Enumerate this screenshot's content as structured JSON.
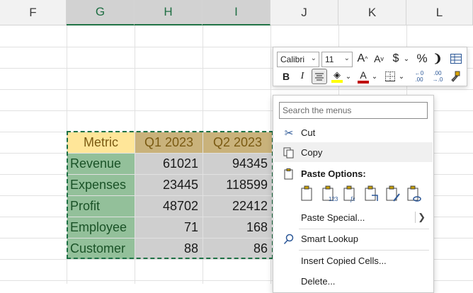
{
  "columns": [
    "F",
    "G",
    "H",
    "I",
    "J",
    "K",
    "L"
  ],
  "table": {
    "headers": [
      "Metric",
      "Q1 2023",
      "Q2 2023"
    ],
    "rows": [
      {
        "metric": "Revenue",
        "q1": "61021",
        "q2": "94345"
      },
      {
        "metric": "Expenses",
        "q1": "23445",
        "q2": "118599"
      },
      {
        "metric": "Profit",
        "q1": "48702",
        "q2": "22412"
      },
      {
        "metric": "Employee",
        "q1": "71",
        "q2": "168"
      },
      {
        "metric": "Customer",
        "q1": "88",
        "q2": "86"
      }
    ]
  },
  "mini_toolbar": {
    "font_name": "Calibri",
    "font_size": "11",
    "grow_font": "A",
    "shrink_font": "A",
    "currency": "$",
    "percent": "%",
    "comma": "❩",
    "bold": "B",
    "italic": "I",
    "font_color_letter": "A",
    "decrease_decimal_top": "←0",
    "decrease_decimal_bottom": ".00",
    "increase_decimal_top": ".00",
    "increase_decimal_bottom": "→.0"
  },
  "context_menu": {
    "search_placeholder": "Search the menus",
    "cut": "Cut",
    "copy": "Copy",
    "paste_options_header": "Paste Options:",
    "paste_special": "Paste Special...",
    "smart_lookup": "Smart Lookup",
    "insert_copied_cells": "Insert Copied Cells...",
    "delete": "Delete..."
  },
  "colors": {
    "selection_green": "#1e7145",
    "metric_fill": "#93c09a",
    "header_fill": "#c9b27b",
    "metric_header_fill": "#ffe699",
    "number_fill": "#cfcfcf",
    "font_color_bar": "#c00000",
    "fill_color_bar": "#ffff00"
  }
}
